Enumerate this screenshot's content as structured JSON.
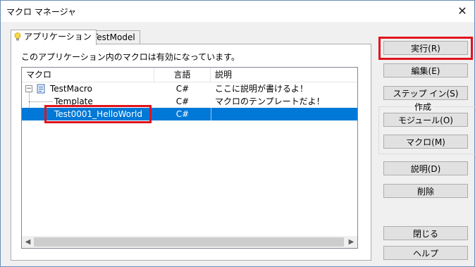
{
  "window": {
    "title": "マクロ マネージャ"
  },
  "tabs": [
    {
      "label": "アプリケーション",
      "icon": "lightbulb-icon"
    },
    {
      "label": "TestModel",
      "icon": "lightbulb-icon"
    }
  ],
  "panel": {
    "info": "このアプリケーション内のマクロは有効になっています。"
  },
  "list": {
    "headers": [
      "マクロ",
      "言語",
      "説明"
    ],
    "rows": [
      {
        "name": "TestMacro",
        "lang": "C#",
        "desc": "ここに説明が書けるよ！"
      },
      {
        "name": "Template",
        "lang": "C#",
        "desc": "マクロのテンプレートだよ！"
      },
      {
        "name": "Test0001_HelloWorld",
        "lang": "C#",
        "desc": ""
      }
    ]
  },
  "buttons": {
    "run": "実行(R)",
    "edit": "編集(E)",
    "step_into": "ステップ イン(S)",
    "create_group": "作成",
    "module": "モジュール(O)",
    "macro": "マクロ(M)",
    "description": "説明(D)",
    "delete": "削除",
    "close": "閉じる",
    "help": "ヘルプ"
  },
  "colors": {
    "selection": "#0078d7",
    "highlight_box": "#e0141e"
  }
}
